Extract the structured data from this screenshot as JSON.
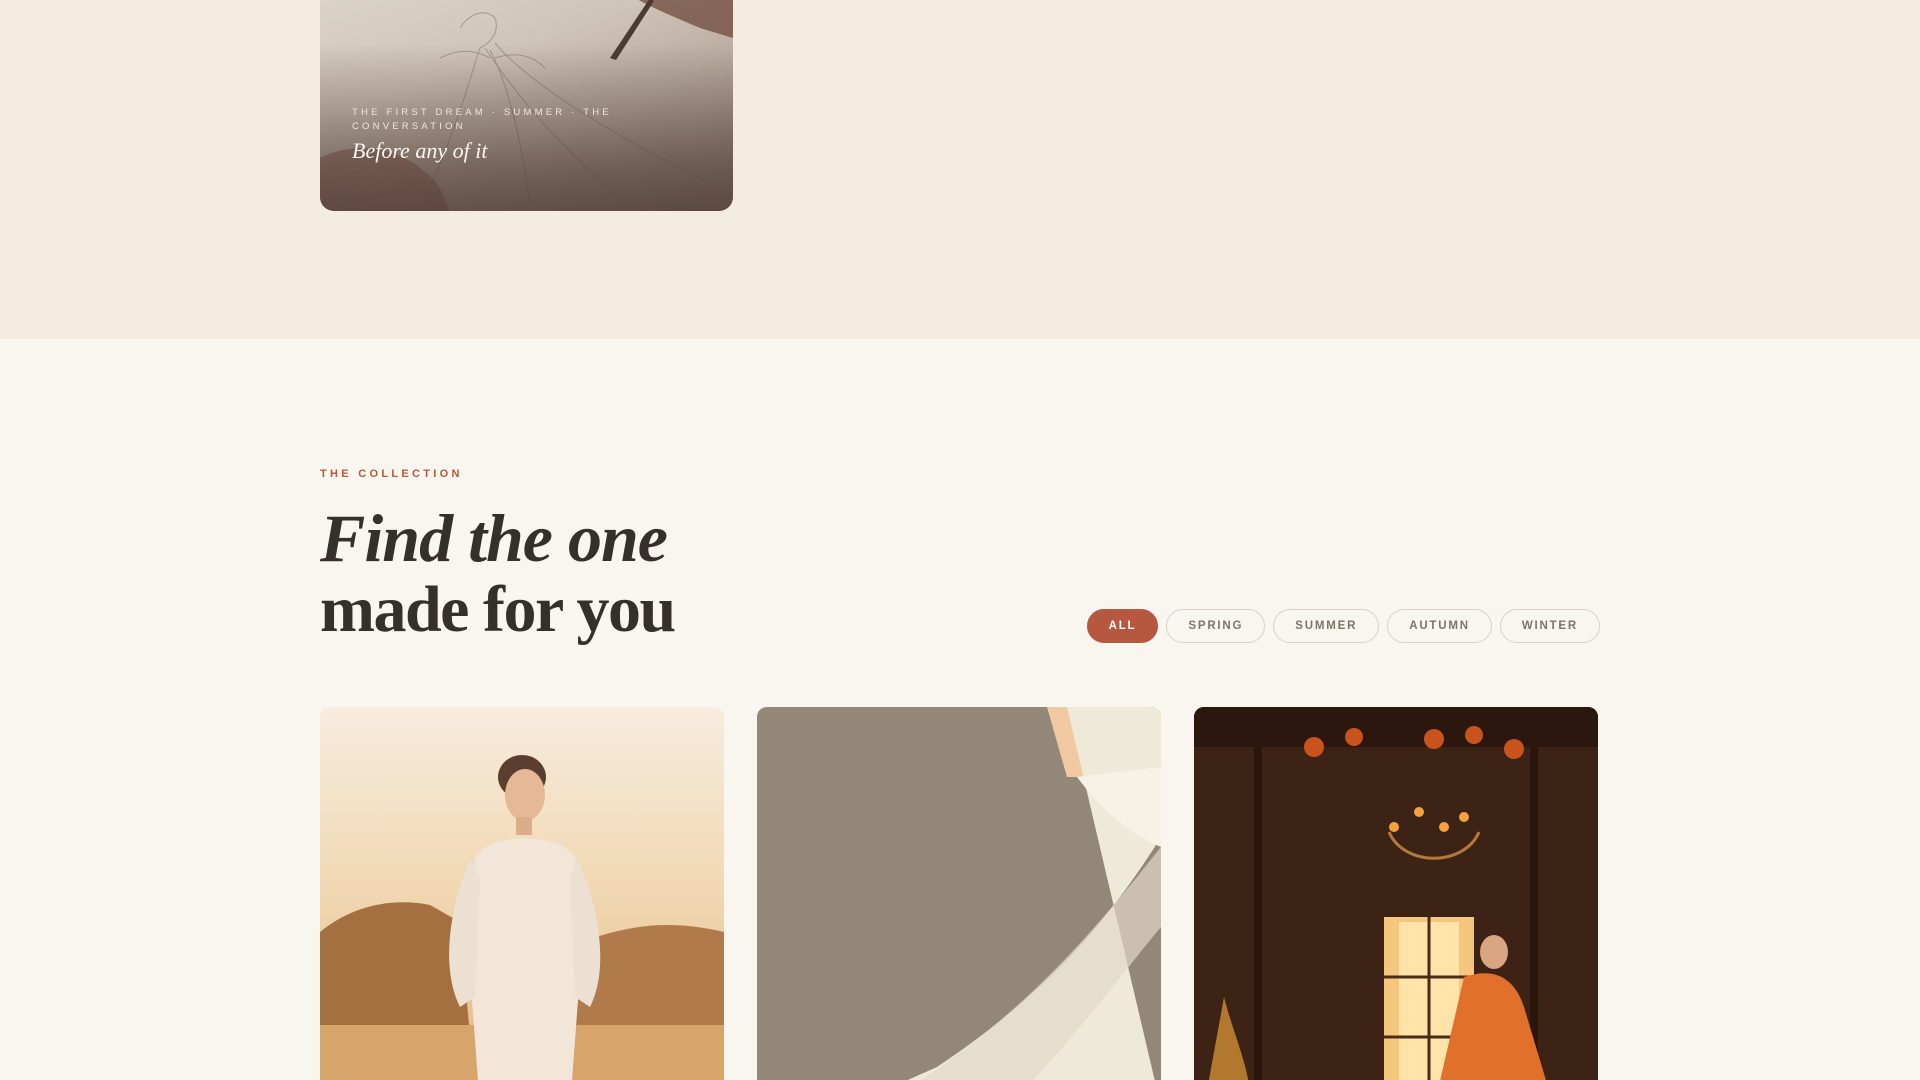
{
  "story": {
    "meta": "THE FIRST DREAM · SUMMER · THE CONVERSATION",
    "title": "Before any of it"
  },
  "collection": {
    "eyebrow": "THE COLLECTION",
    "heading_line1": "Find the one",
    "heading_line2": "made for you",
    "filters": [
      {
        "label": "ALL",
        "active": true
      },
      {
        "label": "SPRING",
        "active": false
      },
      {
        "label": "SUMMER",
        "active": false
      },
      {
        "label": "AUTUMN",
        "active": false
      },
      {
        "label": "WINTER",
        "active": false
      }
    ],
    "cards": [
      {
        "name": "desert-dress-photo"
      },
      {
        "name": "flowing-gown-photo"
      },
      {
        "name": "autumn-barn-photo"
      }
    ]
  },
  "colors": {
    "accent": "#b5583f",
    "band_background": "#f4ece0",
    "page_background": "#f9f6ef",
    "heading_text": "#35302c"
  }
}
